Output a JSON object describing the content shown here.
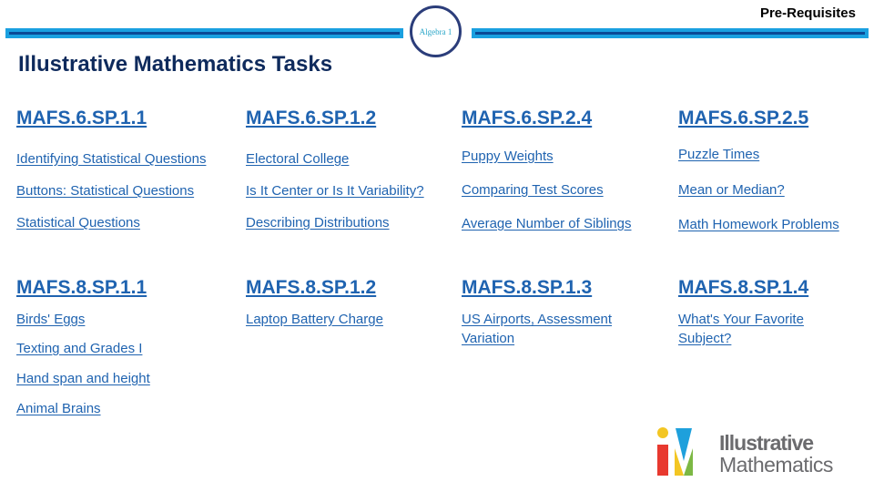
{
  "header": {
    "badge_label": "Algebra 1",
    "prerequisites_label": "Pre-Requisites",
    "title": "Illustrative Mathematics Tasks"
  },
  "grade6": [
    {
      "standard": "MAFS.6.SP.1.1",
      "tasks": [
        "Identifying Statistical Questions",
        "Buttons: Statistical Questions",
        "Statistical Questions"
      ]
    },
    {
      "standard": "MAFS.6.SP.1.2",
      "tasks": [
        "Electoral College",
        "Is It Center or Is It Variability?",
        "Describing Distributions"
      ]
    },
    {
      "standard": "MAFS.6.SP.2.4",
      "tasks": [
        "Puppy Weights",
        "Comparing Test Scores",
        "Average Number of Siblings"
      ]
    },
    {
      "standard": "MAFS.6.SP.2.5",
      "tasks": [
        "Puzzle Times",
        "Mean or Median?",
        "Math Homework Problems"
      ]
    }
  ],
  "grade8": [
    {
      "standard": "MAFS.8.SP.1.1",
      "tasks": [
        "Birds' Eggs",
        "Texting and Grades I",
        "Hand span and height",
        "Animal Brains"
      ]
    },
    {
      "standard": "MAFS.8.SP.1.2",
      "tasks": [
        "Laptop Battery Charge"
      ]
    },
    {
      "standard": "MAFS.8.SP.1.3",
      "tasks": [
        "US Airports, Assessment Variation"
      ]
    },
    {
      "standard": "MAFS.8.SP.1.4",
      "tasks": [
        "What's Your Favorite Subject?"
      ]
    }
  ],
  "logo": {
    "line1": "Illustrative",
    "line2": "Mathematics",
    "colors": {
      "red": "#e8392f",
      "yellow": "#f3c623",
      "blue": "#1ea0dc",
      "green": "#7cb844",
      "text": "#6b6b6e"
    }
  }
}
